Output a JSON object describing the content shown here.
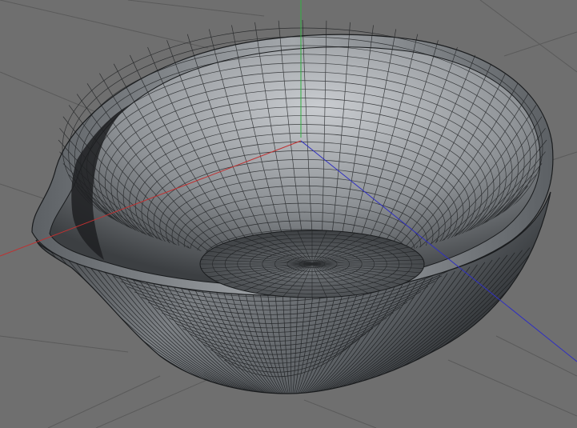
{
  "viewport": {
    "background_color": "#6f6f6f",
    "grid_color": "#5a5a5a",
    "shaded": true,
    "wireframe_on_shaded": true
  },
  "axes": {
    "x_color": "#c03030",
    "y_color": "#30b040",
    "z_color": "#3030c0"
  },
  "object": {
    "type": "bowl-with-spout",
    "surface_light": "#b8bcc0",
    "surface_dark": "#2e3134",
    "wire_color": "#1a1c1e"
  }
}
